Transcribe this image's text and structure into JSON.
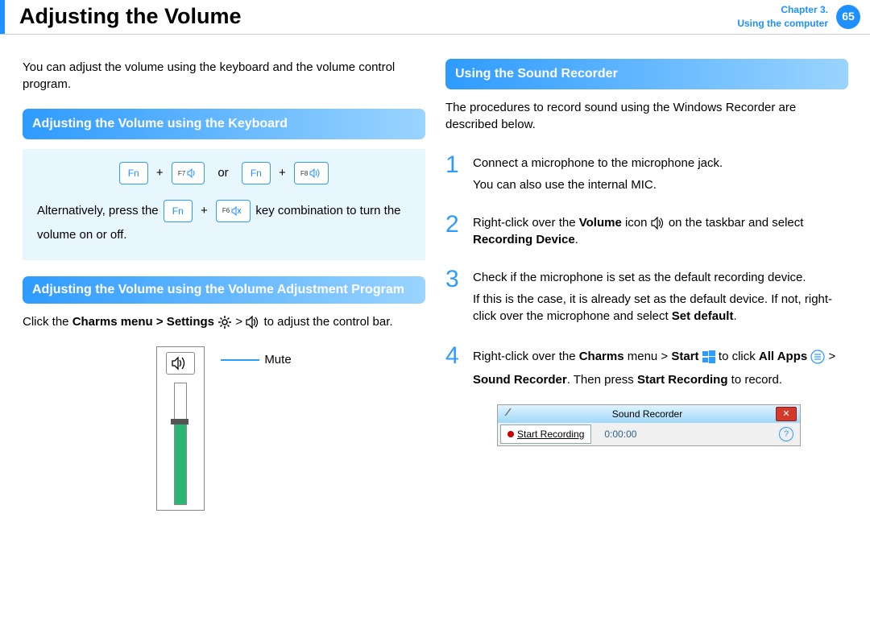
{
  "header": {
    "title": "Adjusting the Volume",
    "chapter_line1": "Chapter 3.",
    "chapter_line2": "Using the computer",
    "page_number": "65"
  },
  "left": {
    "intro": "You can adjust the volume using the keyboard and the volume control program.",
    "section1_title": "Adjusting the Volume using the Keyboard",
    "keys": {
      "fn": "Fn",
      "f7": "F7",
      "f8": "F8",
      "f6": "F6",
      "plus": "+",
      "or": "or"
    },
    "alt_prefix": "Alternatively, press the ",
    "alt_suffix": " key combination to turn the volume on or off.",
    "section2_title": "Adjusting the Volume using the Volume Adjustment Program",
    "charms_prefix": "Click the ",
    "charms_menu": "Charms menu > Settings",
    "charms_suffix": " to adjust the control bar.",
    "mute_label": "Mute"
  },
  "right": {
    "section_title": "Using the Sound Recorder",
    "intro": "The procedures to record sound using the Windows Recorder are described below.",
    "steps": [
      {
        "num": "1",
        "line1": "Connect a microphone to the microphone jack.",
        "line2": "You can also use the internal MIC."
      },
      {
        "num": "2",
        "prefix": "Right-click over the ",
        "bold1": "Volume",
        "mid": " icon ",
        "suffix": " on the taskbar and select ",
        "bold2": "Recording Device",
        "end": "."
      },
      {
        "num": "3",
        "line1": "Check if the microphone is set as the default recording device.",
        "line2_prefix": "If this is the case, it is already set as the default device. If not, right-click over the microphone and select ",
        "line2_bold": "Set default",
        "line2_end": "."
      },
      {
        "num": "4",
        "prefix": "Right-click over the ",
        "bold1": "Charms",
        "mid1": " menu > ",
        "bold2": "Start",
        "mid2": " to click ",
        "bold3": "All Apps",
        "mid3": " > ",
        "bold4": "Sound Recorder",
        "mid4": ". Then press ",
        "bold5": "Start Recording",
        "end": " to record."
      }
    ],
    "sound_recorder": {
      "title": "Sound Recorder",
      "button": "Start Recording",
      "time": "0:00:00",
      "close": "✕",
      "help": "?"
    },
    "gt": " > "
  }
}
